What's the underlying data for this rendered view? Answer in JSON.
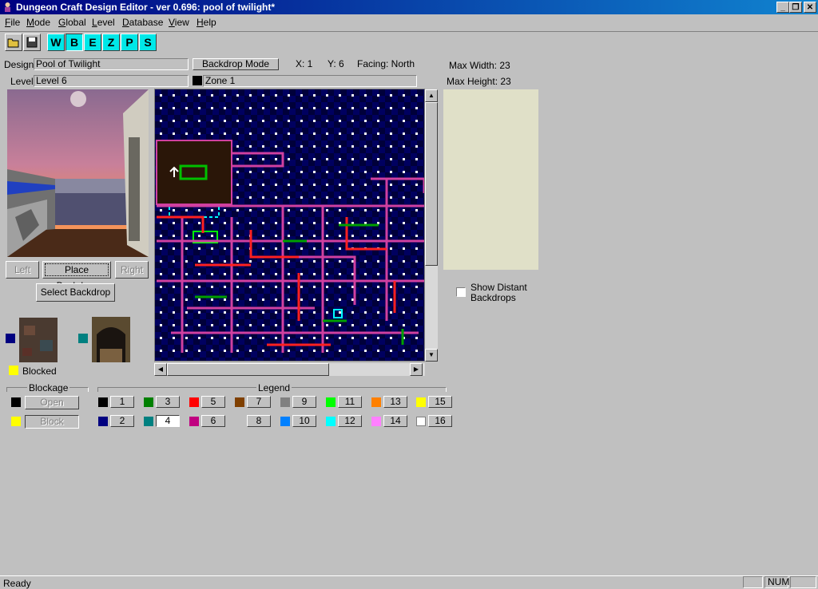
{
  "window": {
    "title": "Dungeon Craft Design Editor - ver 0.696: pool of twilight*"
  },
  "menu": [
    {
      "u": "F",
      "rest": "ile"
    },
    {
      "u": "M",
      "rest": "ode"
    },
    {
      "u": "G",
      "rest": "lobal"
    },
    {
      "u": "L",
      "rest": "evel"
    },
    {
      "u": "D",
      "rest": "atabase"
    },
    {
      "u": "V",
      "rest": "iew"
    },
    {
      "u": "H",
      "rest": "elp"
    }
  ],
  "toolbar": {
    "modes": [
      "W",
      "B",
      "E",
      "Z",
      "P",
      "S"
    ]
  },
  "info": {
    "design_label": "Design",
    "design_value": "Pool of Twilight",
    "level_label": "Level",
    "level_value": "Level 6",
    "mode": "Backdrop Mode",
    "x": "X:  1",
    "y": "Y: 6",
    "facing": "Facing: North",
    "zone": "Zone 1",
    "max_width": "Max Width: 23",
    "max_height": "Max Height: 23"
  },
  "buttons": {
    "left": "Left",
    "place": "Place Backdrop",
    "right": "Right",
    "select": "Select Backdrop",
    "open": "Open",
    "block": "Block"
  },
  "labels": {
    "blocked": "Blocked",
    "blockage": "Blockage",
    "legend": "Legend",
    "show_distant": "Show Distant",
    "backdrops": "Backdrops"
  },
  "legend_items": [
    {
      "n": "1",
      "color": "#000000"
    },
    {
      "n": "2",
      "color": "#000080"
    },
    {
      "n": "3",
      "color": "#008000"
    },
    {
      "n": "4",
      "color": "#008080"
    },
    {
      "n": "5",
      "color": "#ff0000"
    },
    {
      "n": "6",
      "color": "#c00080"
    },
    {
      "n": "7",
      "color": "#804000"
    },
    {
      "n": "8",
      "color": "#c0c0c0"
    },
    {
      "n": "9",
      "color": "#808080"
    },
    {
      "n": "10",
      "color": "#0080ff"
    },
    {
      "n": "11",
      "color": "#00ff00"
    },
    {
      "n": "12",
      "color": "#00ffff"
    },
    {
      "n": "13",
      "color": "#ff8000"
    },
    {
      "n": "14",
      "color": "#ff80ff"
    },
    {
      "n": "15",
      "color": "#ffff00"
    },
    {
      "n": "16",
      "color": "#ffffff"
    }
  ],
  "status": {
    "ready": "Ready",
    "num": "NUM"
  },
  "icons": [
    "folder-open-icon",
    "save-icon",
    "minimize-icon",
    "restore-icon",
    "close-icon"
  ]
}
